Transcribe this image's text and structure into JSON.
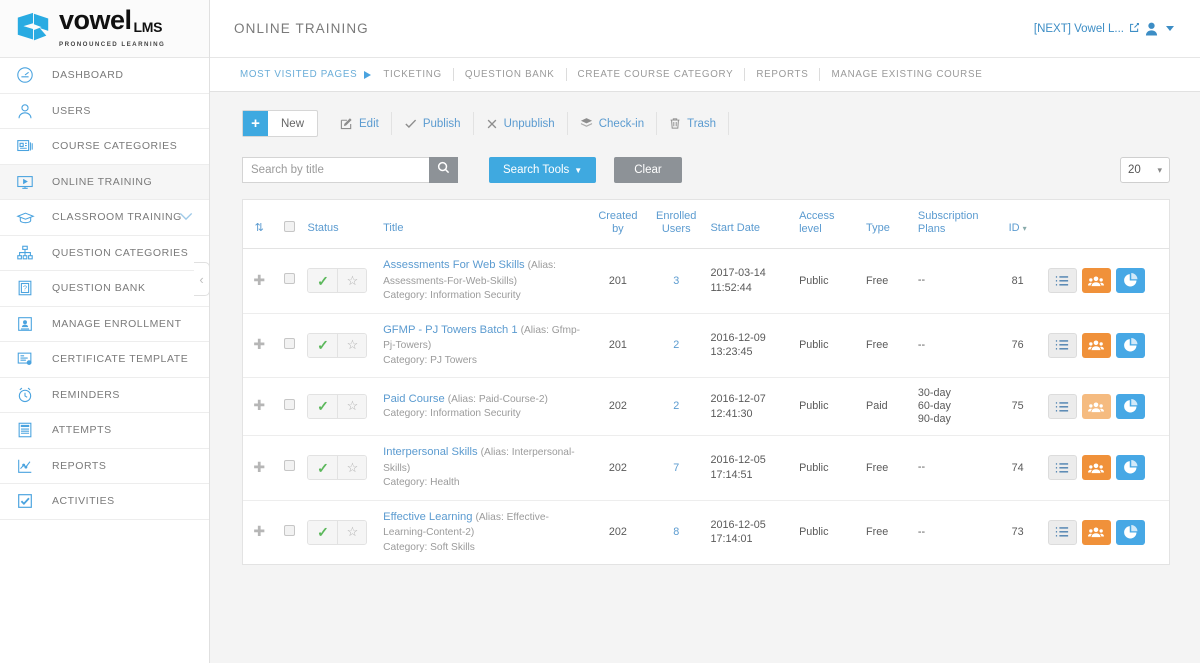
{
  "brand": {
    "name": "vowel",
    "suffix": "LMS",
    "tagline": "PRONOUNCED LEARNING"
  },
  "sidebar": {
    "collapse_icon": "chevron-left-icon",
    "items": [
      {
        "label": "DASHBOARD",
        "icon": "speedometer-icon",
        "active": false,
        "expandable": false
      },
      {
        "label": "USERS",
        "icon": "user-icon",
        "active": false,
        "expandable": false
      },
      {
        "label": "COURSE CATEGORIES",
        "icon": "course-categories-icon",
        "active": false,
        "expandable": false
      },
      {
        "label": "ONLINE TRAINING",
        "icon": "monitor-play-icon",
        "active": true,
        "expandable": false
      },
      {
        "label": "CLASSROOM TRAINING",
        "icon": "graduation-cap-icon",
        "active": false,
        "expandable": true
      },
      {
        "label": "QUESTION CATEGORIES",
        "icon": "sitemap-icon",
        "active": false,
        "expandable": false
      },
      {
        "label": "QUESTION BANK",
        "icon": "question-book-icon",
        "active": false,
        "expandable": false
      },
      {
        "label": "MANAGE ENROLLMENT",
        "icon": "id-card-icon",
        "active": false,
        "expandable": false
      },
      {
        "label": "CERTIFICATE TEMPLATE",
        "icon": "certificate-icon",
        "active": false,
        "expandable": false
      },
      {
        "label": "REMINDERS",
        "icon": "alarm-clock-icon",
        "active": false,
        "expandable": false
      },
      {
        "label": "ATTEMPTS",
        "icon": "document-lines-icon",
        "active": false,
        "expandable": false
      },
      {
        "label": "REPORTS",
        "icon": "line-chart-icon",
        "active": false,
        "expandable": false
      },
      {
        "label": "ACTIVITIES",
        "icon": "checkbox-check-icon",
        "active": false,
        "expandable": false
      }
    ]
  },
  "header": {
    "page_title": "ONLINE TRAINING",
    "account_label": "[NEXT] Vowel L...",
    "external_icon": "external-link-icon",
    "user_icon": "user-avatar-icon"
  },
  "quickbar": {
    "lead": "MOST VISITED PAGES",
    "links": [
      "TICKETING",
      "QUESTION BANK",
      "CREATE COURSE CATEGORY",
      "REPORTS",
      "MANAGE EXISTING COURSE"
    ]
  },
  "toolbar": {
    "new_label": "New",
    "edit_label": "Edit",
    "publish_label": "Publish",
    "unpublish_label": "Unpublish",
    "checkin_label": "Check-in",
    "trash_label": "Trash"
  },
  "search": {
    "placeholder": "Search by title",
    "value": "",
    "search_icon": "magnifier-icon",
    "tools_label": "Search Tools",
    "clear_label": "Clear",
    "page_size": "20"
  },
  "table": {
    "headers": {
      "sort": "⇅",
      "check": "",
      "status": "Status",
      "title": "Title",
      "created_by": "Created by",
      "enrolled_users": "Enrolled Users",
      "start_date": "Start Date",
      "access_level": "Access level",
      "type": "Type",
      "subscription_plans": "Subscription Plans",
      "id": "ID"
    },
    "rows": [
      {
        "title": "Assessments For Web Skills",
        "alias": "(Alias: Assessments-For-Web-Skills)",
        "category": "Category: Information Security",
        "created_by": "201",
        "enrolled_users": "3",
        "start_date_day": "2017-03-14",
        "start_date_time": "11:52:44",
        "access_level": "Public",
        "type": "Free",
        "subscription_plans": [
          "--"
        ],
        "id": "81",
        "published": true,
        "featured": false,
        "users_button_muted": false
      },
      {
        "title": "GFMP - PJ Towers Batch 1",
        "alias": "(Alias: Gfmp-Pj-Towers)",
        "category": "Category: PJ Towers",
        "created_by": "201",
        "enrolled_users": "2",
        "start_date_day": "2016-12-09",
        "start_date_time": "13:23:45",
        "access_level": "Public",
        "type": "Free",
        "subscription_plans": [
          "--"
        ],
        "id": "76",
        "published": true,
        "featured": false,
        "users_button_muted": false
      },
      {
        "title": "Paid Course",
        "alias": "(Alias: Paid-Course-2)",
        "category": "Category: Information Security",
        "created_by": "202",
        "enrolled_users": "2",
        "start_date_day": "2016-12-07",
        "start_date_time": "12:41:30",
        "access_level": "Public",
        "type": "Paid",
        "subscription_plans": [
          "30-day",
          "60-day",
          "90-day"
        ],
        "id": "75",
        "published": true,
        "featured": false,
        "users_button_muted": true
      },
      {
        "title": "Interpersonal Skills",
        "alias": "(Alias: Interpersonal-Skills)",
        "category": "Category: Health",
        "created_by": "202",
        "enrolled_users": "7",
        "start_date_day": "2016-12-05",
        "start_date_time": "17:14:51",
        "access_level": "Public",
        "type": "Free",
        "subscription_plans": [
          "--"
        ],
        "id": "74",
        "published": true,
        "featured": false,
        "users_button_muted": false
      },
      {
        "title": "Effective Learning",
        "alias": "(Alias: Effective-Learning-Content-2)",
        "category": "Category: Soft Skills",
        "created_by": "202",
        "enrolled_users": "8",
        "start_date_day": "2016-12-05",
        "start_date_time": "17:14:01",
        "access_level": "Public",
        "type": "Free",
        "subscription_plans": [
          "--"
        ],
        "id": "73",
        "published": true,
        "featured": false,
        "users_button_muted": false
      }
    ]
  },
  "colors": {
    "accent_blue": "#3fa9e0",
    "link_blue": "#5b9bd0",
    "orange": "#f0913a",
    "grey_button": "#8d9297",
    "green_check": "#5cb85c"
  }
}
